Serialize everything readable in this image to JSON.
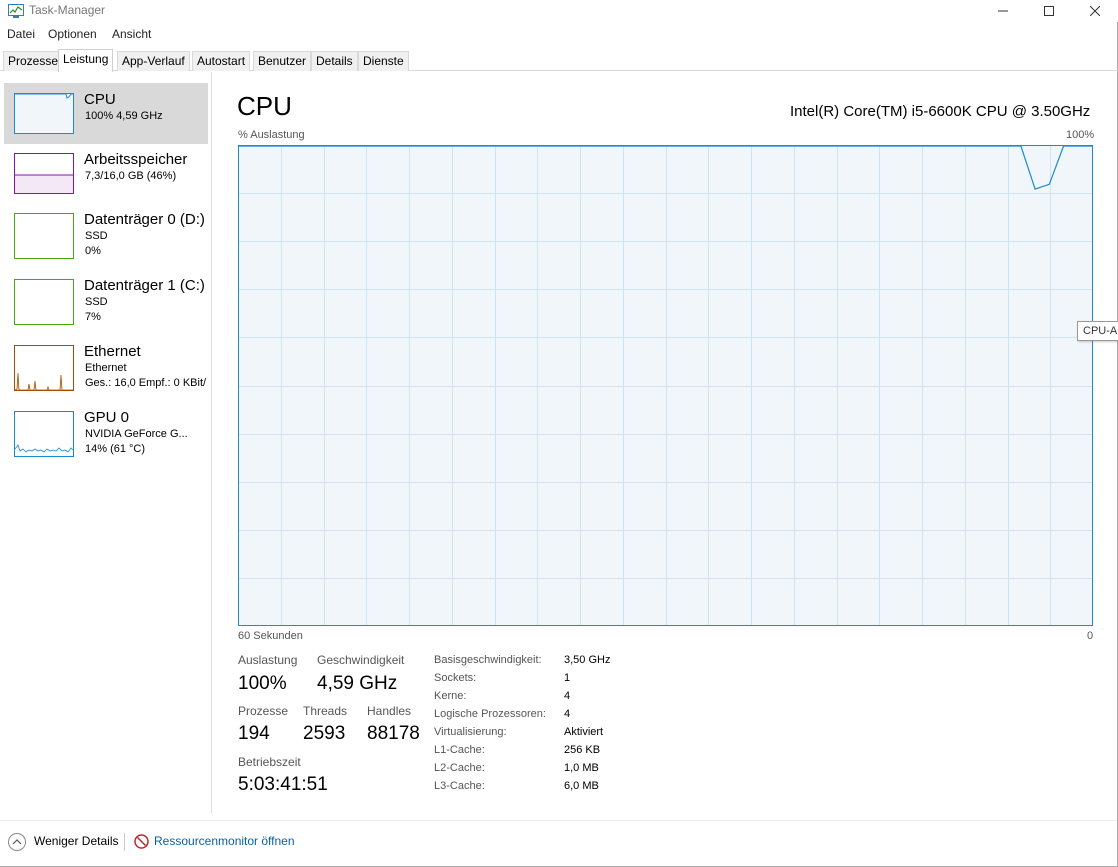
{
  "window": {
    "title": "Task-Manager"
  },
  "menu": [
    "Datei",
    "Optionen",
    "Ansicht"
  ],
  "tabs": [
    "Prozesse",
    "Leistung",
    "App-Verlauf",
    "Autostart",
    "Benutzer",
    "Details",
    "Dienste"
  ],
  "active_tab": "Leistung",
  "sidebar": {
    "items": [
      {
        "title": "CPU",
        "lines": [
          "100%  4,59 GHz"
        ],
        "color": "#1a8bd0",
        "selected": true
      },
      {
        "title": "Arbeitsspeicher",
        "lines": [
          "7,3/16,0 GB (46%)"
        ],
        "color": "#8b12ae",
        "selected": false
      },
      {
        "title": "Datenträger 0 (D:)",
        "lines": [
          "SSD",
          "0%"
        ],
        "color": "#4da60c",
        "selected": false
      },
      {
        "title": "Datenträger 1 (C:)",
        "lines": [
          "SSD",
          "7%"
        ],
        "color": "#4da60c",
        "selected": false
      },
      {
        "title": "Ethernet",
        "lines": [
          "Ethernet",
          "Ges.: 16,0  Empf.: 0 KBit/"
        ],
        "color": "#a74f01",
        "selected": false
      },
      {
        "title": "GPU 0",
        "lines": [
          "NVIDIA GeForce G...",
          "14%  (61 °C)"
        ],
        "color": "#1a8bd0",
        "selected": false
      }
    ]
  },
  "main": {
    "title": "CPU",
    "model": "Intel(R) Core(TM) i5-6600K CPU @ 3.50GHz",
    "y_axis_label": "% Auslastung",
    "y_axis_max": "100%",
    "x_axis_left": "60 Sekunden",
    "x_axis_right": "0",
    "tooltip": "CPU-Auslastung",
    "graph_color": "#1a8bd0",
    "stats": {
      "utilization": {
        "label": "Auslastung",
        "value": "100%"
      },
      "speed": {
        "label": "Geschwindigkeit",
        "value": "4,59 GHz"
      },
      "processes": {
        "label": "Prozesse",
        "value": "194"
      },
      "threads": {
        "label": "Threads",
        "value": "2593"
      },
      "handles": {
        "label": "Handles",
        "value": "88178"
      },
      "uptime": {
        "label": "Betriebszeit",
        "value": "5:03:41:51"
      }
    },
    "specs": [
      {
        "label": "Basisgeschwindigkeit:",
        "value": "3,50 GHz"
      },
      {
        "label": "Sockets:",
        "value": "1"
      },
      {
        "label": "Kerne:",
        "value": "4"
      },
      {
        "label": "Logische Prozessoren:",
        "value": "4"
      },
      {
        "label": "Virtualisierung:",
        "value": "Aktiviert"
      },
      {
        "label": "L1-Cache:",
        "value": "256 KB"
      },
      {
        "label": "L2-Cache:",
        "value": "1,0 MB"
      },
      {
        "label": "L3-Cache:",
        "value": "6,0 MB"
      }
    ]
  },
  "footer": {
    "fewer_details": "Weniger Details",
    "resource_monitor": "Ressourcenmonitor öffnen"
  },
  "chart_data": {
    "type": "line",
    "ylabel": "% Auslastung",
    "ylim": [
      0,
      100
    ],
    "xlim": [
      60,
      0
    ],
    "series": [
      {
        "x": [
          60,
          50,
          40,
          30,
          20,
          10,
          5,
          4,
          3,
          2,
          1,
          0
        ],
        "values": [
          100,
          100,
          100,
          100,
          100,
          100,
          100,
          91,
          92,
          100,
          100,
          100
        ]
      }
    ]
  }
}
